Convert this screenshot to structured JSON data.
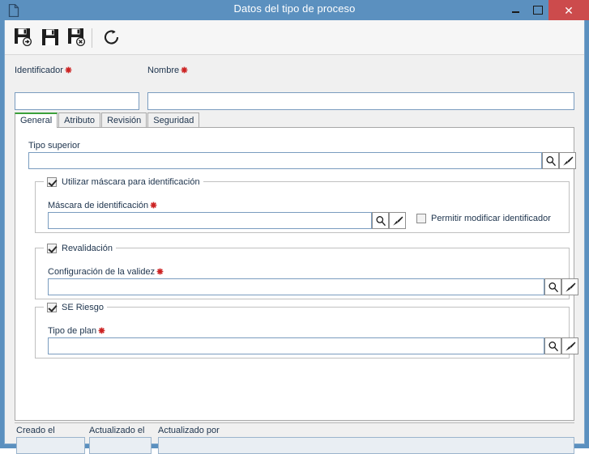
{
  "window": {
    "title": "Datos del tipo de proceso",
    "icon": "document-icon",
    "controls": {
      "minimize": "minimize-icon",
      "maximize": "maximize-icon",
      "close": "close-icon"
    },
    "colors": {
      "titlebar": "#5b90bf",
      "close_button": "#cc4b4c",
      "accent_tab": "#3aa03a",
      "required_marker": "#cc2222",
      "field_border": "#7a9cbf"
    }
  },
  "toolbar": {
    "items": [
      {
        "name": "save-and-new-button",
        "icon": "floppy-arrow-icon",
        "tooltip": "Guardar y nuevo"
      },
      {
        "name": "save-button",
        "icon": "floppy-icon",
        "tooltip": "Guardar"
      },
      {
        "name": "save-and-close-button",
        "icon": "floppy-close-icon",
        "tooltip": "Guardar y cerrar"
      },
      {
        "name": "refresh-button",
        "icon": "refresh-icon",
        "tooltip": "Actualizar"
      }
    ]
  },
  "header_fields": {
    "identificador": {
      "label": "Identificador",
      "required": true,
      "value": "",
      "placeholder": ""
    },
    "nombre": {
      "label": "Nombre",
      "required": true,
      "value": "",
      "placeholder": ""
    }
  },
  "tabs": [
    {
      "label": "General",
      "active": true
    },
    {
      "label": "Atributo",
      "active": false
    },
    {
      "label": "Revisión",
      "active": false
    },
    {
      "label": "Seguridad",
      "active": false
    }
  ],
  "general_tab": {
    "tipo_superior": {
      "label": "Tipo superior",
      "required": false,
      "value": "",
      "search_icon": "magnifier-icon",
      "clear_icon": "brush-icon"
    },
    "mascara_group": {
      "title": "Utilizar máscara para identificación",
      "checked": true,
      "field": {
        "label": "Máscara de identificación",
        "required": true,
        "value": "",
        "search_icon": "magnifier-icon",
        "clear_icon": "brush-icon"
      },
      "permitir_modificar": {
        "label": "Permitir modificar identificador",
        "checked": false
      }
    },
    "revalidacion_group": {
      "title": "Revalidación",
      "checked": true,
      "field": {
        "label": "Configuración de la validez",
        "required": true,
        "value": "",
        "search_icon": "magnifier-icon",
        "clear_icon": "brush-icon"
      }
    },
    "riesgo_group": {
      "title": "SE Riesgo",
      "checked": true,
      "field": {
        "label": "Tipo de plan",
        "required": true,
        "value": "",
        "search_icon": "magnifier-icon",
        "clear_icon": "brush-icon"
      }
    }
  },
  "footer": {
    "creado_el": {
      "label": "Creado el",
      "value": "",
      "disabled": true
    },
    "actualizado_el": {
      "label": "Actualizado el",
      "value": "",
      "disabled": true
    },
    "actualizado_por": {
      "label": "Actualizado por",
      "value": "",
      "disabled": true
    }
  }
}
